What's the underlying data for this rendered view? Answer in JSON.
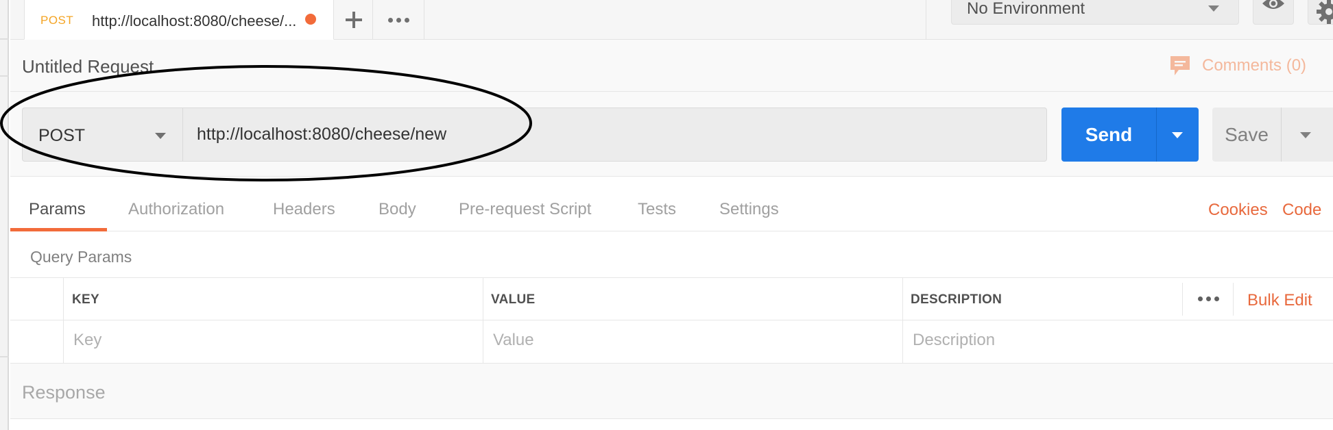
{
  "tab": {
    "method": "POST",
    "title": "http://localhost:8080/cheese/...",
    "unsaved": true
  },
  "environment": {
    "selected": "No Environment"
  },
  "request": {
    "name": "Untitled Request",
    "comments_label": "Comments (0)",
    "method": "POST",
    "url": "http://localhost:8080/cheese/new",
    "send_label": "Send",
    "save_label": "Save"
  },
  "subtabs": [
    {
      "label": "Params",
      "active": true
    },
    {
      "label": "Authorization",
      "active": false
    },
    {
      "label": "Headers",
      "active": false
    },
    {
      "label": "Body",
      "active": false
    },
    {
      "label": "Pre-request Script",
      "active": false
    },
    {
      "label": "Tests",
      "active": false
    },
    {
      "label": "Settings",
      "active": false
    }
  ],
  "links": {
    "cookies": "Cookies",
    "code": "Code"
  },
  "query_params": {
    "title": "Query Params",
    "columns": [
      "KEY",
      "VALUE",
      "DESCRIPTION"
    ],
    "placeholders": {
      "key": "Key",
      "value": "Value",
      "description": "Description"
    },
    "bulk_edit": "Bulk Edit"
  },
  "response": {
    "label": "Response"
  },
  "colors": {
    "accent": "#f26b3a",
    "send": "#1f7be8",
    "method_tab": "#f4a423"
  }
}
